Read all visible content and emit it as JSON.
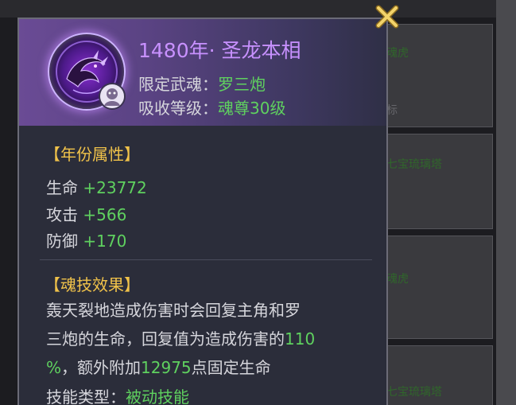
{
  "popup": {
    "title": "1480年·  圣龙本相",
    "spirit_label": "限定武魂：",
    "spirit_value": "罗三炮",
    "level_label": "吸收等级：",
    "level_value": "魂尊30级"
  },
  "year_attributes": {
    "title": "【年份属性】",
    "stats": [
      {
        "name": "生命",
        "value": "+23772"
      },
      {
        "name": "攻击",
        "value": "+566"
      },
      {
        "name": "防御",
        "value": "+170"
      }
    ]
  },
  "skill_effect": {
    "title": "【魂技效果】",
    "line1": "轰天裂地造成伤害时会回复主角和罗",
    "line2_text": "三炮的生命，回复值为造成伤害的",
    "line2_value": "110",
    "line3_value_a": "%",
    "line3_text": "，额外附加",
    "line3_value_b": "12975",
    "line3_text_b": "点固定生命",
    "type_label": "技能类型：",
    "type_value": "被动技能"
  },
  "background_list": {
    "items": [
      "魂虎",
      "标",
      "七宝琉璃塔",
      "魂虎",
      "七宝琉璃塔"
    ]
  },
  "icons": {
    "close": "close-x-icon",
    "soul_ring": "dragon-soul-ring-icon",
    "badge": "avatar-badge-icon"
  },
  "colors": {
    "title": "#c891ff",
    "value_green": "#5fd15f",
    "section_gold": "#f0c24a",
    "close_gold": "#e7c24a"
  }
}
